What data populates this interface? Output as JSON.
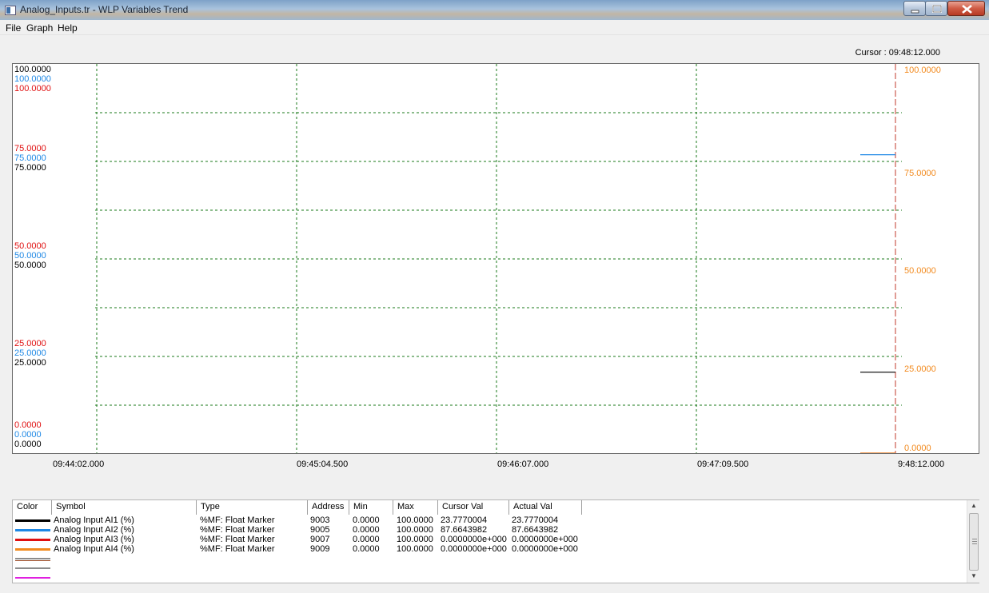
{
  "window": {
    "title": "Analog_Inputs.tr - WLP Variables Trend"
  },
  "menu": [
    "File",
    "Graph",
    "Help"
  ],
  "cursor_label": "Cursor : 09:48:12.000",
  "axes": {
    "left_black": [
      "100.0000",
      "75.0000",
      "50.0000",
      "25.0000",
      "0.0000"
    ],
    "left_blue": [
      "100.0000",
      "75.0000",
      "50.0000",
      "25.0000",
      "0.0000"
    ],
    "left_red": [
      "100.0000",
      "75.0000",
      "50.0000",
      "25.0000",
      "0.0000"
    ],
    "right_orange": [
      "100.0000",
      "75.0000",
      "50.0000",
      "25.0000",
      "0.0000"
    ],
    "x_ticks": [
      "09:44:02.000",
      "09:45:04.500",
      "09:46:07.000",
      "09:47:09.500",
      "9:48:12.000"
    ]
  },
  "colors": {
    "ai1": "#000000",
    "ai2": "#1e88e5",
    "ai3": "#e01010",
    "ai4": "#f28a1e",
    "grid": "#1a7a1a",
    "cursor_line": "#c0392b"
  },
  "table": {
    "headers": [
      "Color",
      "Symbol",
      "Type",
      "Address",
      "Min",
      "Max",
      "Cursor Val",
      "Actual Val"
    ],
    "rows": [
      {
        "color": "#000000",
        "symbol": "Analog Input AI1 (%)",
        "type": "%MF: Float Marker",
        "address": "9003",
        "min": "0.0000",
        "max": "100.0000",
        "cursor_val": "23.7770004",
        "actual_val": "23.7770004"
      },
      {
        "color": "#1e88e5",
        "symbol": "Analog Input AI2 (%)",
        "type": "%MF: Float Marker",
        "address": "9005",
        "min": "0.0000",
        "max": "100.0000",
        "cursor_val": "87.6643982",
        "actual_val": "87.6643982"
      },
      {
        "color": "#e01010",
        "symbol": "Analog Input AI3 (%)",
        "type": "%MF: Float Marker",
        "address": "9007",
        "min": "0.0000",
        "max": "100.0000",
        "cursor_val": "0.0000000e+000",
        "actual_val": "0.0000000e+000"
      },
      {
        "color": "#f28a1e",
        "symbol": "Analog Input AI4 (%)",
        "type": "%MF: Float Marker",
        "address": "9009",
        "min": "0.0000",
        "max": "100.0000",
        "cursor_val": "0.0000000e+000",
        "actual_val": "0.0000000e+000"
      }
    ],
    "empty_swatches": [
      "#8c8c8c",
      "#a0522d",
      "#e020e0"
    ]
  },
  "chart_data": {
    "type": "line",
    "x": [
      "09:44:02.000",
      "09:45:04.500",
      "09:46:07.000",
      "09:47:09.500",
      "9:48:12.000"
    ],
    "ylim": [
      0,
      100
    ],
    "grid": true,
    "cursor": "09:48:12.000",
    "series": [
      {
        "name": "Analog Input AI1 (%)",
        "color": "#000000",
        "points": [
          [
            "09:48:01",
            23.78
          ],
          [
            "09:48:12",
            23.78
          ]
        ]
      },
      {
        "name": "Analog Input AI2 (%)",
        "color": "#1e88e5",
        "points": [
          [
            "09:48:01",
            87.66
          ],
          [
            "09:48:12",
            87.66
          ]
        ]
      },
      {
        "name": "Analog Input AI3 (%)",
        "color": "#e01010",
        "points": [
          [
            "09:48:01",
            0
          ],
          [
            "09:48:12",
            0
          ]
        ]
      },
      {
        "name": "Analog Input AI4 (%)",
        "color": "#f28a1e",
        "points": [
          [
            "09:48:01",
            0
          ],
          [
            "09:48:12",
            0
          ]
        ]
      }
    ]
  }
}
